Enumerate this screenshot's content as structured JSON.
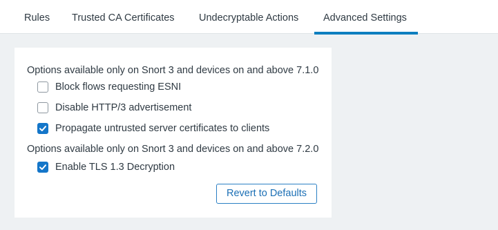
{
  "tabs": [
    {
      "label": "Rules"
    },
    {
      "label": "Trusted CA Certificates"
    },
    {
      "label": "Undecryptable Actions"
    },
    {
      "label": "Advanced Settings",
      "active": true
    }
  ],
  "sections": [
    {
      "label": "Options available only on Snort 3 and devices on and above 7.1.0",
      "options": [
        {
          "label": "Block flows requesting ESNI",
          "checked": false
        },
        {
          "label": "Disable HTTP/3 advertisement",
          "checked": false
        },
        {
          "label": "Propagate untrusted server certificates to clients",
          "checked": true
        }
      ]
    },
    {
      "label": "Options available only on Snort 3 and devices on and above 7.2.0",
      "options": [
        {
          "label": "Enable TLS 1.3 Decryption",
          "checked": true
        }
      ]
    }
  ],
  "revert_button": {
    "label": "Revert to Defaults"
  },
  "colors": {
    "accent": "#0d7fbf",
    "checkbox_checked": "#1476c9",
    "background": "#eef1f3"
  },
  "icons": {
    "checkbox_check": "checkmark-icon"
  }
}
